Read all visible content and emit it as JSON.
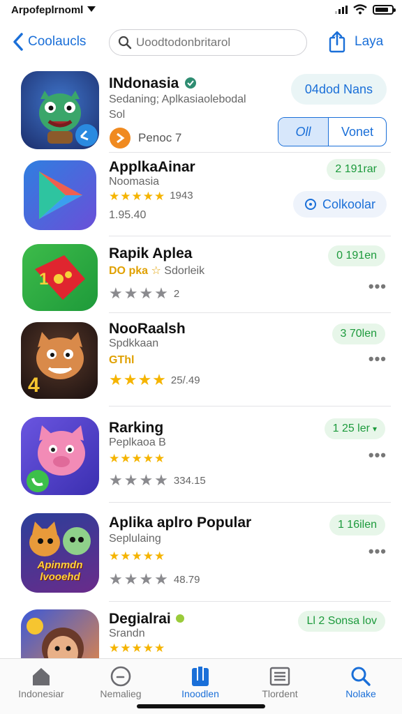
{
  "status": {
    "carrier": "Arpofeplrnoml"
  },
  "nav": {
    "back_label": "Coolaucls",
    "search_placeholder": "Uoodtodonbritarol",
    "share_label": "Laya"
  },
  "apps": [
    {
      "title": "INdonasia",
      "subtitle": "Sedaning; Aplkasiaolebodal",
      "subtitle2": "Sol",
      "meta_text": "Penoc 7",
      "action_primary": "04dod Nans",
      "segment": [
        "Oll",
        "Vonet"
      ]
    },
    {
      "title": "ApplkaAinar",
      "subtitle": "Noomasia",
      "stars_rating": 4.5,
      "stars_count_text": "1943",
      "size_text": "1.95.40",
      "action_primary": "2 191rar",
      "action_secondary": "Colkoolar"
    },
    {
      "title": "Rapik Aplea",
      "subtitle_colored": "DO pka",
      "subtitle": "Sdorleik",
      "gray_rating_text": "2",
      "action_primary": "0 191en"
    },
    {
      "title": "NooRaalsh",
      "subtitle": "Spdkkaan",
      "subtitle_colored": "GThl",
      "stars_rating": 4,
      "stars_count_text": "25/.49",
      "action_primary": "3 70len"
    },
    {
      "title": "Rarking",
      "subtitle": "Peplkaoa B",
      "stars_rating": 4.5,
      "gray_rating_text": "334.15",
      "action_primary": "1 25 ler"
    },
    {
      "title": "Aplika aplro Popular",
      "subtitle": "Seplulaing",
      "stars_rating": 4.5,
      "gray_rating_text": "48.79",
      "action_primary": "1 16ilen",
      "icon_text": "Apinmdn lvooehd"
    },
    {
      "title": "Degialrai",
      "subtitle": "Srandn",
      "stars_rating": 4.5,
      "action_primary": "Ll 2 Sonsa lov"
    }
  ],
  "tabs": [
    {
      "label": "Indonesiar",
      "icon": "home-icon"
    },
    {
      "label": "Nemalieg",
      "icon": "clock-icon"
    },
    {
      "label": "Inoodlen",
      "icon": "apps-icon",
      "active": true
    },
    {
      "label": "Tlordent",
      "icon": "list-icon"
    },
    {
      "label": "Nolake",
      "icon": "search-icon"
    }
  ],
  "colors": {
    "accent": "#1a6fd8",
    "get_pill_bg": "#e7f6e9",
    "get_pill_text": "#1c9a3c",
    "star": "#f5b400"
  }
}
